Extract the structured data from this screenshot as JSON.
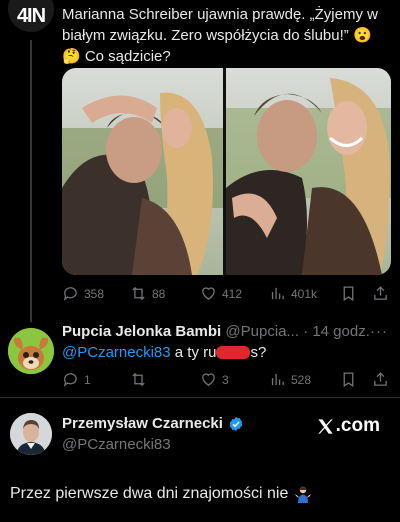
{
  "tweet": {
    "avatar_text": "4IN",
    "text": "Marianna Schreiber ujawnia prawdę. „Żyjemy w białym związku. Zero współżycia do ślubu!” 😮 🤔 Co sądzicie?",
    "stats": {
      "replies": "358",
      "retweets": "88",
      "likes": "412",
      "views": "401k"
    }
  },
  "reply": {
    "name": "Pupcia Jelonka Bambi",
    "handle": "@Pupcia...",
    "time": "· 14 godz.",
    "more": "···",
    "mention": "@PCzarnecki83",
    "text_before": "a ty ru",
    "text_after": "s?",
    "stats": {
      "replies": "1",
      "retweets": "",
      "likes": "3",
      "views": "528"
    }
  },
  "quoted": {
    "name": "Przemysław Czarnecki",
    "handle": "@PCzarnecki83",
    "brand": ".com",
    "text": "Przez pierwsze dwa dni znajomości nie"
  },
  "colors": {
    "accent": "#1d9bf0",
    "muted": "#71767b",
    "redaction": "#e0262f"
  }
}
